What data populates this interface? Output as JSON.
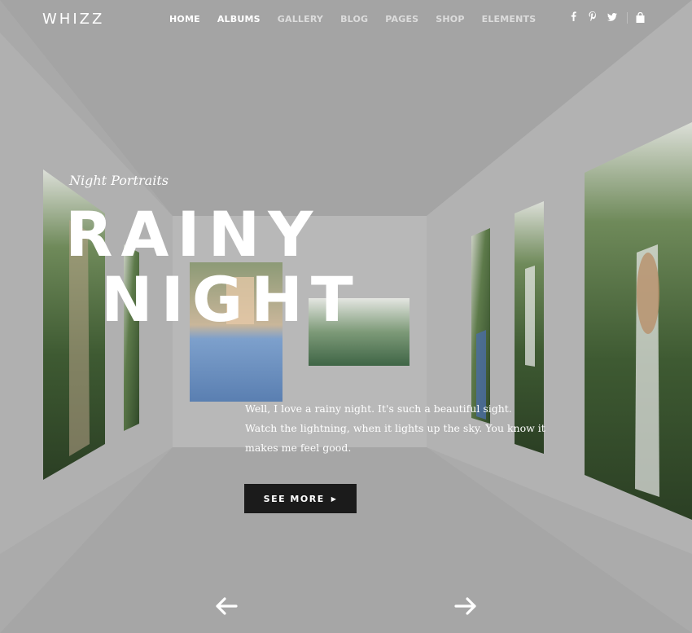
{
  "header": {
    "logo": "WHIZZ",
    "nav": [
      {
        "label": "HOME",
        "active": true
      },
      {
        "label": "ALBUMS",
        "active": true
      },
      {
        "label": "GALLERY",
        "active": false
      },
      {
        "label": "BLOG",
        "active": false
      },
      {
        "label": "PAGES",
        "active": false
      },
      {
        "label": "SHOP",
        "active": false
      },
      {
        "label": "ELEMENTS",
        "active": false
      }
    ],
    "social": [
      {
        "name": "facebook-icon",
        "glyph": "f"
      },
      {
        "name": "pinterest-icon",
        "glyph": "p"
      },
      {
        "name": "twitter-icon",
        "glyph": "t"
      }
    ],
    "cart_icon": "shopping-bag-icon"
  },
  "hero": {
    "subtitle": "Night Portraits",
    "title_line_1": "RAINY",
    "title_line_2": "NIGHT",
    "description": "Well, I love a rainy night. It's such a beautiful sight. Watch the lightning, when it lights up the sky. You know it makes me feel good.",
    "button_label": "SEE MORE",
    "button_icon": "caret-right-icon"
  },
  "navigation": {
    "prev_icon": "arrow-left-icon",
    "next_icon": "arrow-right-icon"
  },
  "colors": {
    "ceiling": "#a4a4a4",
    "left_wall": "#b0b0b0",
    "right_wall": "#b2b2b2",
    "back_wall": "#b8b8b8",
    "floor": "#a6a6a6",
    "button_bg": "#1b1b1b",
    "text": "#ffffff"
  }
}
